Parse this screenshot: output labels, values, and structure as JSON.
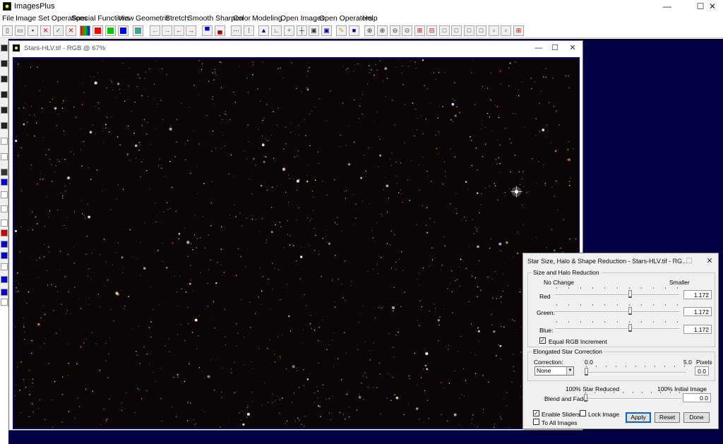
{
  "app": {
    "title": "ImagesPlus",
    "window_controls": {
      "minimize": "—",
      "maximize": "☐",
      "close": "✕"
    }
  },
  "menu": [
    "File",
    "Image Set Operations",
    "Special Functions",
    "View",
    "Geometric",
    "Stretch",
    "Smooth Sharpen",
    "Color",
    "Modeling",
    "Open Images",
    "Open Operators",
    "Help"
  ],
  "toolbar": {
    "icons": [
      "new-icon",
      "open-icon",
      "save-icon",
      "close-icon",
      "check-icon",
      "close-all-icon",
      "rgb-icon",
      "red-icon",
      "green-icon",
      "blue-icon",
      "channel-icon",
      "arrow-left-icon",
      "arrow-right-icon",
      "arrow-left-red-icon",
      "arrow-right-red-icon",
      "align-top-icon",
      "align-bottom-icon",
      "dots-icon",
      "grid-icon",
      "histogram-icon",
      "axes-icon",
      "plus-icon",
      "crosshair-icon",
      "frame-icon",
      "frame-blue-icon",
      "pencil-icon",
      "stop-icon",
      "zoom-icon",
      "zoom-in-icon",
      "zoom-out-icon",
      "zoom-fit-icon",
      "zoom-red-icon",
      "zoom-minus-icon",
      "box1-icon",
      "box2-icon",
      "box3-icon",
      "box4-icon",
      "box5-icon",
      "box6-icon",
      "box-grid-icon"
    ],
    "colors": {
      "red": "#ff0000",
      "green": "#00c000",
      "blue": "#0000ff"
    }
  },
  "image_window": {
    "title": "Stars-HLV.tif - RGB @ 67%",
    "controls": {
      "minimize": "—",
      "maximize": "☐",
      "close": "✕"
    }
  },
  "dialog": {
    "title": "Star Size, Halo & Shape Reduction - Stars-HLV.tif - RG...",
    "controls": {
      "minimize": "—",
      "maximize": "☐",
      "close": "✕"
    },
    "size_halo": {
      "label": "Size and Halo Reduction",
      "left_caption": "No Change",
      "right_caption": "Smaller",
      "channels": [
        {
          "label": "Red",
          "value": "1.172",
          "level": 0.61
        },
        {
          "label": "Green:",
          "value": "1.172",
          "level": 0.61
        },
        {
          "label": "Blue:",
          "value": "1.172",
          "level": 0.61
        }
      ],
      "equal_rgb": {
        "label": "Equal RGB Increment",
        "checked": true
      }
    },
    "elongated": {
      "label": "Elongated Star Correction",
      "correction_label": "Correction:",
      "min": "0.0",
      "max": "5.0",
      "unit": "Pixels",
      "selected": "None",
      "value": "0.0",
      "level": 0.0
    },
    "blend": {
      "left_caption": "100% Star Reduced",
      "right_caption": "100% Initial Image",
      "label": "Blend and Fade:",
      "value": "0.0",
      "level": 0.0
    },
    "enable_sliders": {
      "label": "Enable Sliders",
      "checked": true
    },
    "lock_image": {
      "label": "Lock Image",
      "checked": false
    },
    "to_all_images": {
      "label": "To All Images",
      "checked": false
    },
    "buttons": {
      "apply": "Apply",
      "reset": "Reset",
      "done": "Done"
    }
  }
}
